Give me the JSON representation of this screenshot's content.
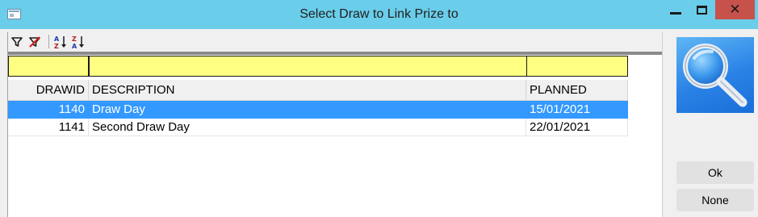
{
  "window": {
    "title": "Select Draw to Link Prize to",
    "close_glyph": "✕"
  },
  "toolbar": {
    "icons": [
      "filter-icon",
      "clear-filter-icon",
      "sort-ascending-icon",
      "sort-descending-icon"
    ]
  },
  "grid": {
    "columns": [
      "DRAWID",
      "DESCRIPTION",
      "PLANNED"
    ],
    "rows": [
      {
        "drawid": "1140",
        "description": "Draw Day",
        "planned": "15/01/2021",
        "selected": true
      },
      {
        "drawid": "1141",
        "description": "Second Draw Day",
        "planned": "22/01/2021",
        "selected": false
      }
    ]
  },
  "side": {
    "ok_label": "Ok",
    "none_label": "None",
    "search_icon": "magnifier-icon"
  },
  "colors": {
    "titlebar": "#6acdea",
    "filter_row": "#fefe82",
    "selection": "#3399ff",
    "close_button": "#c7514b"
  }
}
